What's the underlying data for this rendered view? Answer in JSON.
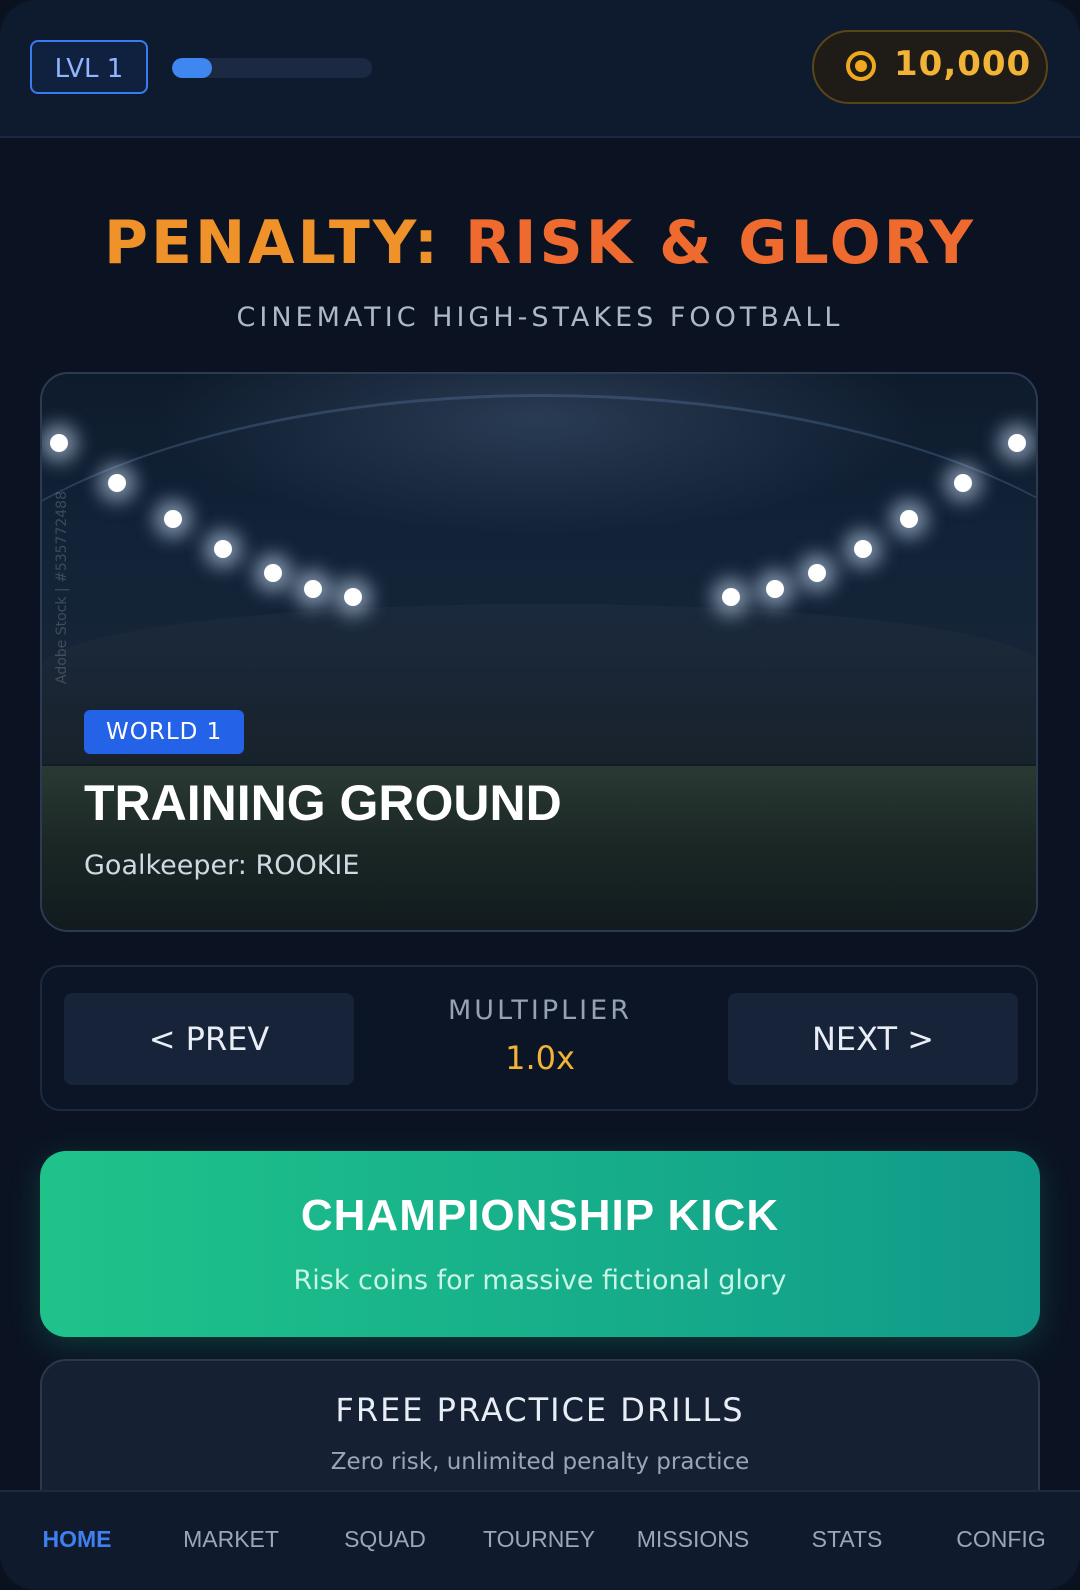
{
  "header": {
    "level_label": "LVL 1",
    "xp_progress": 0.2,
    "coin_icon": "coin-icon",
    "coins": "10,000"
  },
  "hero": {
    "title_part1": "PENALTY: ",
    "title_part2": "RISK & GLORY",
    "subtitle": "CINEMATIC HIGH-STAKES FOOTBALL"
  },
  "world_card": {
    "badge": "WORLD 1",
    "name": "TRAINING GROUND",
    "goalkeeper": "Goalkeeper: ROOKIE",
    "watermark": "Adobe Stock | #535772488"
  },
  "selector": {
    "prev_label": "< PREV",
    "next_label": "NEXT >",
    "multiplier_label": "MULTIPLIER",
    "multiplier_value": "1.0x"
  },
  "championship": {
    "title": "CHAMPIONSHIP KICK",
    "subtitle": "Risk coins for massive fictional glory"
  },
  "practice": {
    "title": "FREE PRACTICE DRILLS",
    "subtitle": "Zero risk, unlimited penalty practice"
  },
  "nav": {
    "items": [
      "HOME",
      "MARKET",
      "SQUAD",
      "TOURNEY",
      "MISSIONS",
      "STATS",
      "CONFIG"
    ],
    "active": "HOME"
  },
  "colors": {
    "accent_blue": "#3f7ff0",
    "coin_gold": "#f2b436",
    "title_orange": "#f0922a",
    "championship_green": "#1fc38a"
  }
}
